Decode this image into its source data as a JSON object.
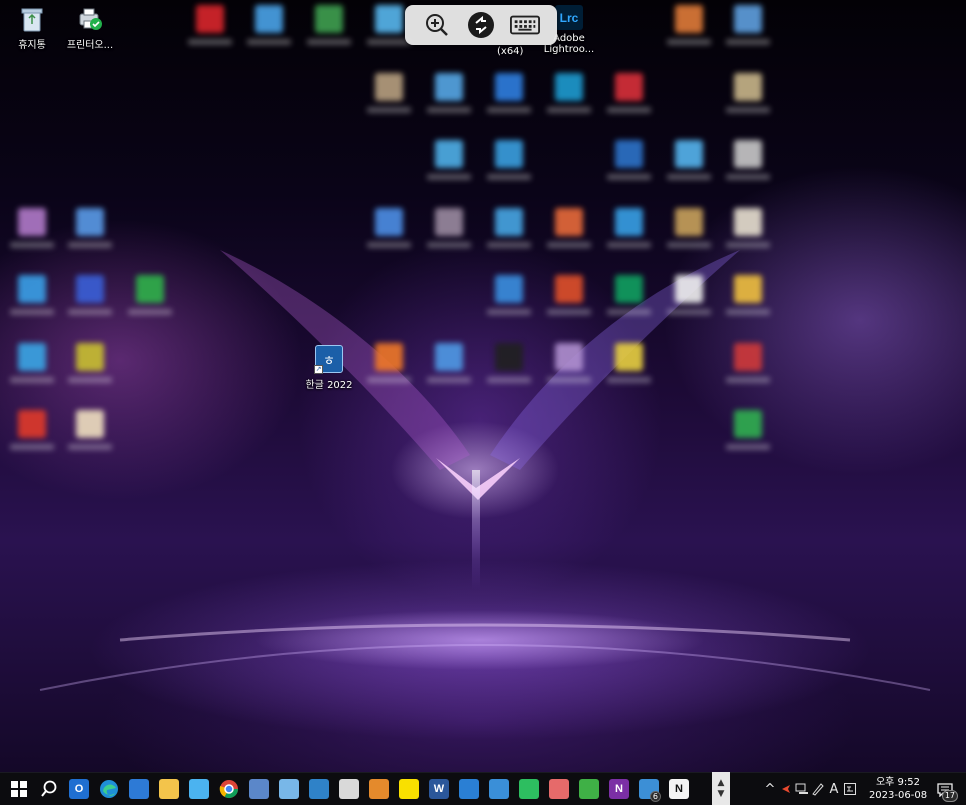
{
  "desktop": {
    "recycle_bin": {
      "label": "휴지통",
      "icon": "recycle-bin-icon"
    },
    "printer_app": {
      "label": "프린터오...",
      "icon": "printer-icon"
    },
    "hangul_shortcut": {
      "label": "한글 2022",
      "icon": "hangul-icon"
    },
    "lightroom_label_line1": "Adobe",
    "lightroom_label_line2": "Lightroo...",
    "x64_label": "(x64)"
  },
  "remote_toolbar": {
    "zoom": {
      "icon": "zoom-in-icon"
    },
    "connection": {
      "icon": "remote-desktop-icon"
    },
    "keyboard": {
      "icon": "keyboard-icon"
    }
  },
  "taskbar": {
    "apps": [
      {
        "name": "start",
        "icon": "windows-start-icon"
      },
      {
        "name": "search",
        "icon": "search-icon"
      },
      {
        "name": "outlook",
        "icon": "outlook-icon",
        "color": "#1f6fd1",
        "text": "O"
      },
      {
        "name": "edge",
        "icon": "edge-icon",
        "color": "#1aa08c"
      },
      {
        "name": "store",
        "icon": "store-icon",
        "color": "#2d7ad6"
      },
      {
        "name": "explorer",
        "icon": "folder-icon",
        "color": "#f3c44b"
      },
      {
        "name": "twitter",
        "icon": "bird-icon",
        "color": "#4bb3f0"
      },
      {
        "name": "chrome",
        "icon": "chrome-icon"
      },
      {
        "name": "pc",
        "icon": "computer-icon",
        "color": "#5b87c9"
      },
      {
        "name": "books",
        "icon": "book-icon",
        "color": "#78b7e8"
      },
      {
        "name": "app-blue",
        "icon": "blue-app-icon",
        "color": "#2f82c8"
      },
      {
        "name": "spinner",
        "icon": "spinner-icon",
        "color": "#d9d9d9"
      },
      {
        "name": "winamp",
        "icon": "winamp-icon",
        "color": "#e48a2c"
      },
      {
        "name": "kakaotalk",
        "icon": "kakaotalk-icon",
        "color": "#f9e000"
      },
      {
        "name": "word",
        "icon": "word-icon",
        "color": "#2b579a",
        "text": "W"
      },
      {
        "name": "paint-app",
        "icon": "brush-icon",
        "color": "#2a7fd4"
      },
      {
        "name": "remote-desktop",
        "icon": "monitor-icon",
        "color": "#3a8fd8"
      },
      {
        "name": "evernote",
        "icon": "evernote-icon",
        "color": "#2dbe60"
      },
      {
        "name": "paint",
        "icon": "palette-icon",
        "color": "#e66a6a"
      },
      {
        "name": "recycle-app",
        "icon": "recycle-icon",
        "color": "#3fb046"
      },
      {
        "name": "onenote",
        "icon": "onenote-icon",
        "color": "#7b2fa5",
        "text": "N"
      },
      {
        "name": "multi-window",
        "icon": "windows-stack-icon",
        "color": "#3c8fd6",
        "badge": "6"
      },
      {
        "name": "notion",
        "icon": "notion-icon",
        "color": "#f4f4f4",
        "text": "N"
      }
    ],
    "tray": {
      "chevron": "^",
      "ime_mode": "A",
      "time": "오후 9:52",
      "date": "2023-06-08",
      "notifications": "17"
    }
  },
  "colors": {
    "taskbar_bg": "#0c0c0f",
    "toolbar_bg": "#ebebeb"
  }
}
